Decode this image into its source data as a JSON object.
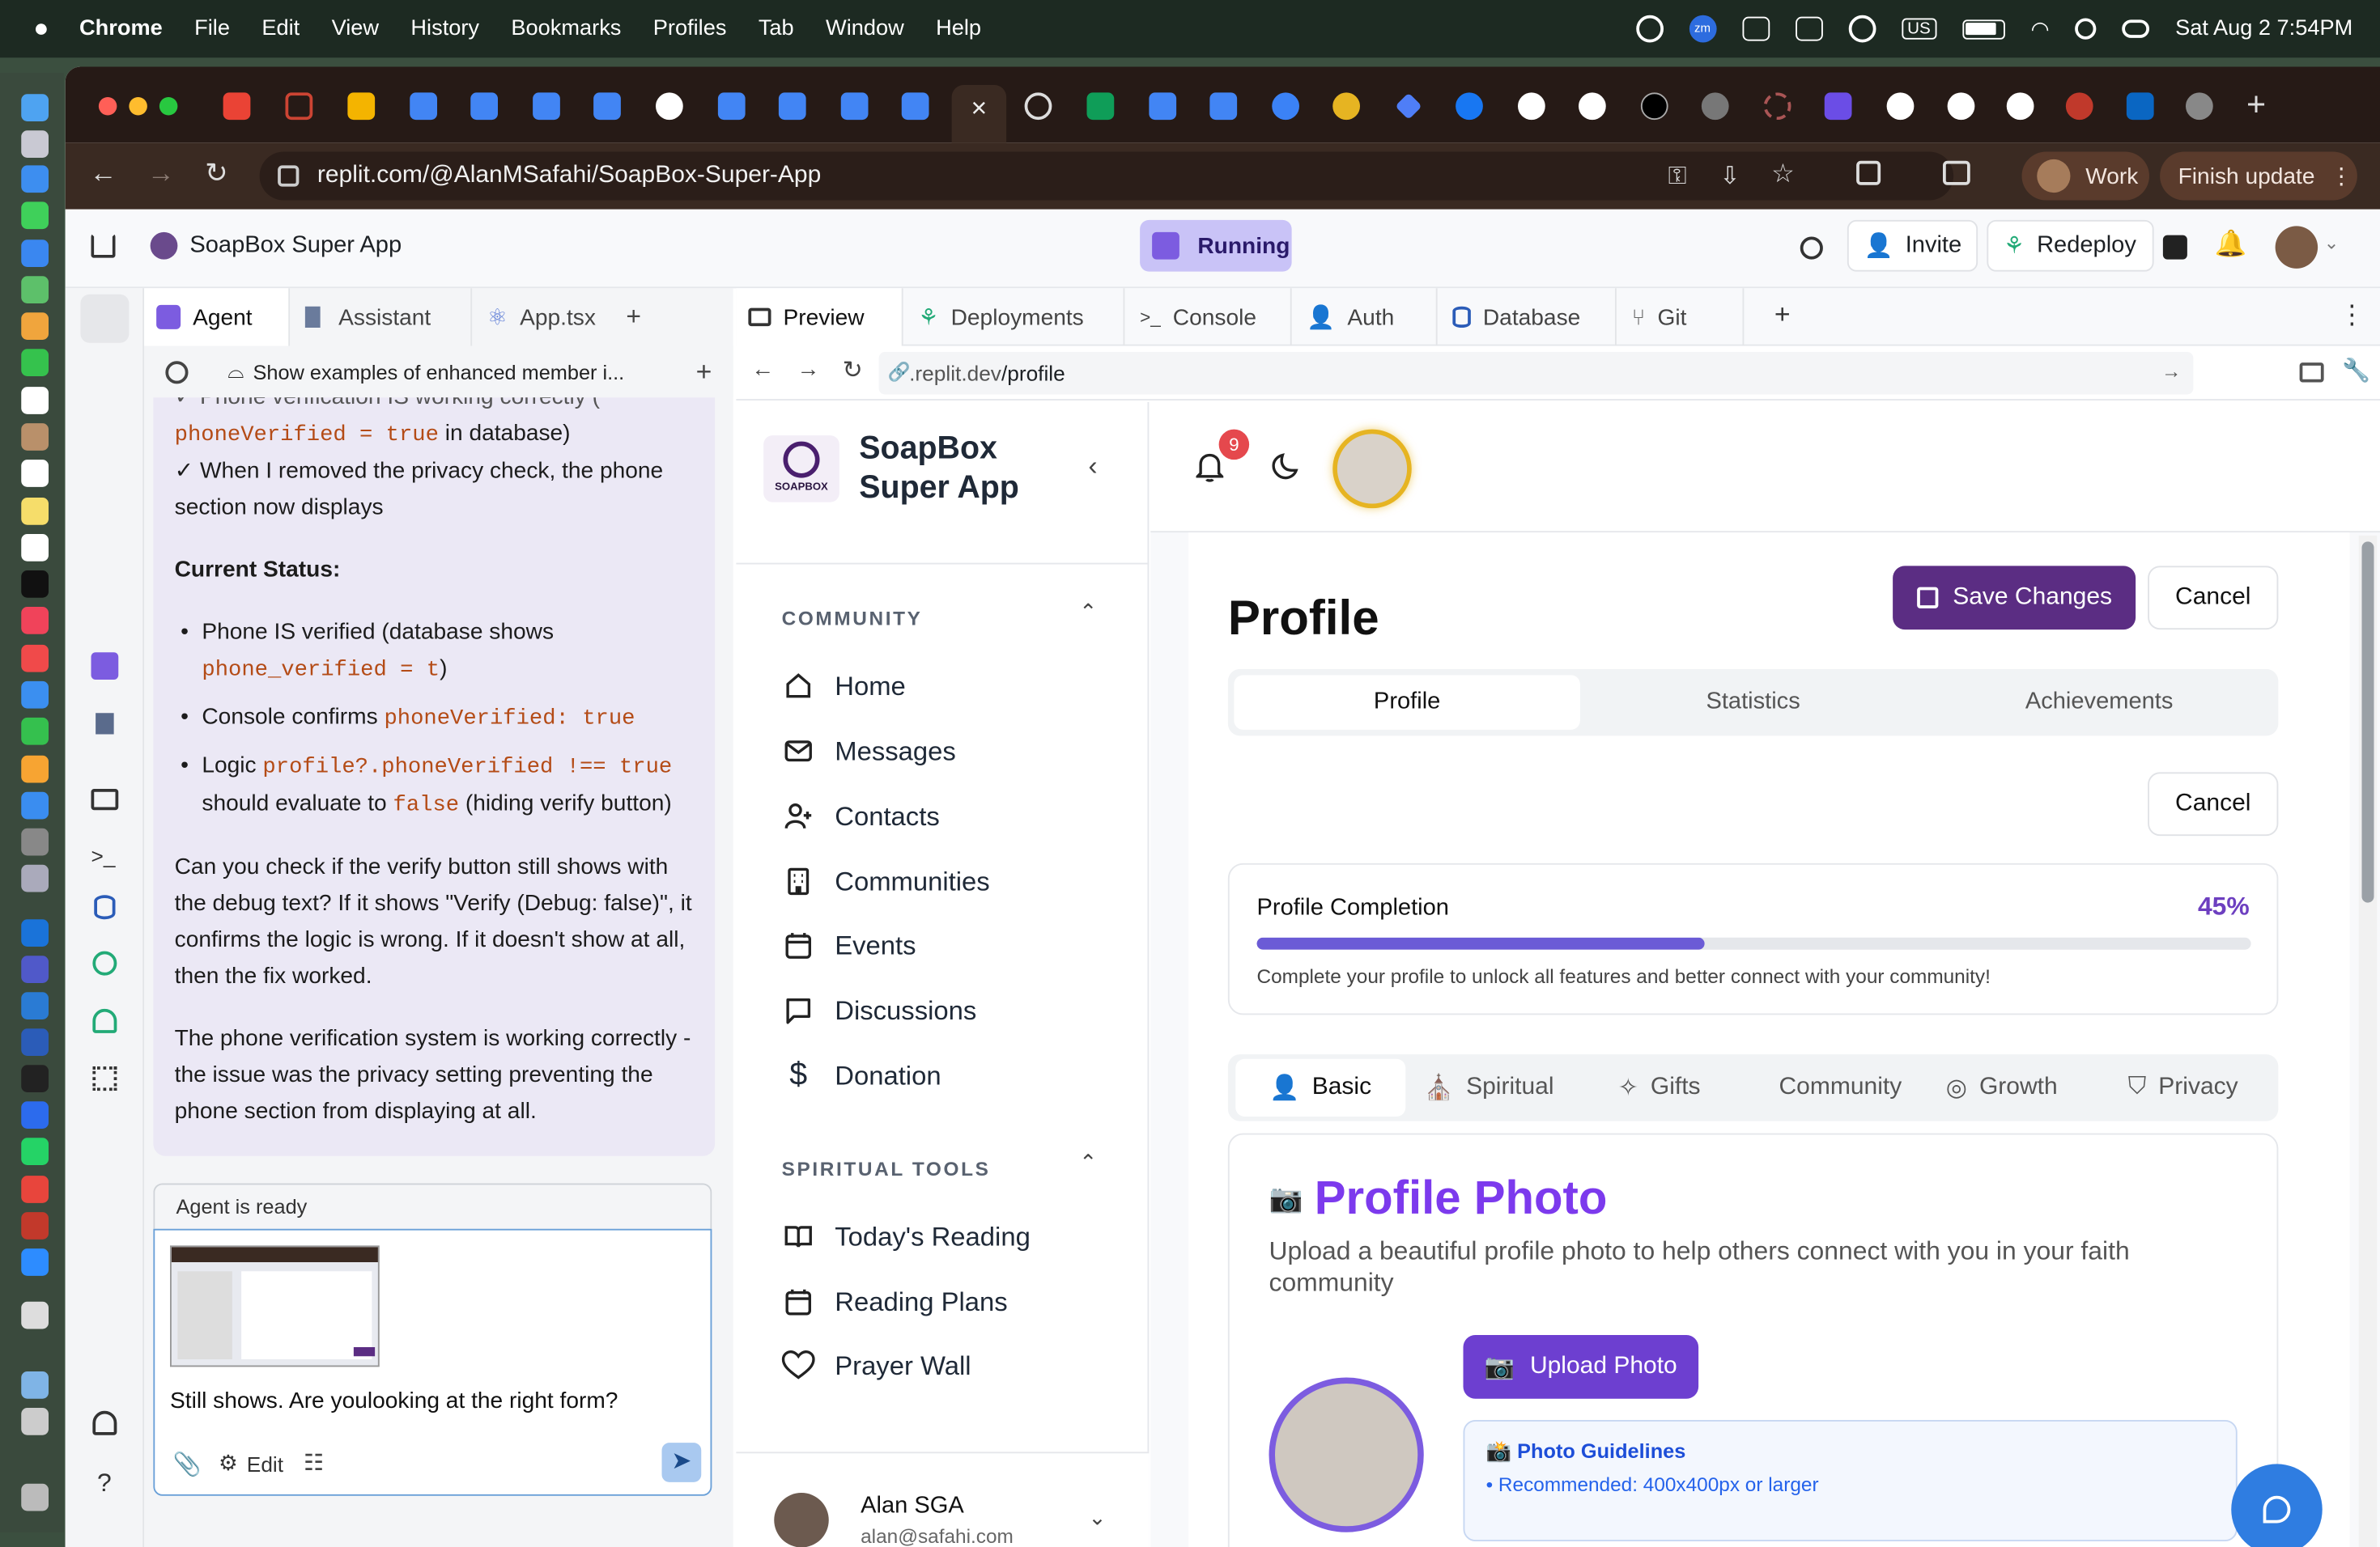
{
  "menubar": {
    "app": "Chrome",
    "items": [
      "File",
      "Edit",
      "View",
      "History",
      "Bookmarks",
      "Profiles",
      "Tab",
      "Window",
      "Help"
    ],
    "input_source": "US",
    "zoom_badge": "zm",
    "datetime": "Sat Aug 2  7:54PM"
  },
  "browser": {
    "url": "replit.com/@AlanMSafahi/SoapBox-Super-App",
    "active_tab_close": "×",
    "profile_label": "Work",
    "update_label": "Finish update"
  },
  "replit": {
    "project_name": "SoapBox Super App",
    "run_status": "Running",
    "invite_label": "Invite",
    "redeploy_label": "Redeploy",
    "left_tabs": [
      "Agent",
      "Assistant",
      "App.tsx"
    ],
    "history_title": "Show examples of enhanced member i...",
    "chat": {
      "l1": "✓ Phone verification IS working correctly (",
      "l2_code": "phoneVerified = true",
      "l2_tail": " in database)",
      "l3": "✓ When I removed the privacy check, the phone section now displays",
      "status_heading": "Current Status:",
      "b1_text": "Phone IS verified (database shows",
      "b1_code": "phone_verified = t",
      "b1_close": ")",
      "b2_text": "Console confirms ",
      "b2_code": "phoneVerified: true",
      "b3_text": "Logic ",
      "b3_code": "profile?.phoneVerified !== true",
      "b3_text2": "should evaluate to ",
      "b3_code2": "false",
      "b3_tail": " (hiding verify button)",
      "p1": "Can you check if the verify button still shows with the debug text? If it shows \"Verify (Debug: false)\", it confirms the logic is wrong. If it doesn't show at all, then the fix worked.",
      "p2": "The phone verification system is working correctly - the issue was the privacy setting preventing the phone section from displaying at all."
    },
    "agent_status": "Agent is ready",
    "composer_text": "Still shows.  Are youlooking at the right form?",
    "edit_label": "Edit",
    "preview_tabs": [
      "Preview",
      "Deployments",
      "Console",
      "Auth",
      "Database",
      "Git"
    ],
    "preview_url_prefix": ".replit.dev",
    "preview_url_path": "/profile"
  },
  "app": {
    "logo_text": "SOAPBOX",
    "brand_line1": "SoapBox",
    "brand_line2": "Super App",
    "community_header": "COMMUNITY",
    "nav": [
      "Home",
      "Messages",
      "Contacts",
      "Communities",
      "Events",
      "Discussions",
      "Donation"
    ],
    "spiritual_header": "SPIRITUAL TOOLS",
    "spiritual_nav": [
      "Today's Reading",
      "Reading Plans",
      "Prayer Wall"
    ],
    "user_name": "Alan SGA",
    "user_email": "alan@safahi.com",
    "notification_count": "9",
    "page_title": "Profile",
    "save_label": "Save Changes",
    "cancel_label": "Cancel",
    "segments": [
      "Profile",
      "Statistics",
      "Achievements"
    ],
    "completion_label": "Profile Completion",
    "completion_percent_text": "45%",
    "completion_value": 0.45,
    "completion_note": "Complete your profile to unlock all features and better connect with your community!",
    "section_tabs": [
      "Basic",
      "Spiritual",
      "Gifts",
      "Community",
      "Growth",
      "Privacy"
    ],
    "photo_title": "Profile Photo",
    "photo_desc": "Upload a beautiful profile photo to help others connect with you in your faith community",
    "upload_label": "Upload Photo",
    "guidelines_title": "📸 Photo Guidelines",
    "guidelines_item": "• Recommended: 400x400px or larger"
  },
  "colors": {
    "accent": "#5b2d83",
    "purple": "#7c3aed",
    "progress": "#6b5bd6",
    "running": "#c9c3f7",
    "code": "#b44b16"
  }
}
